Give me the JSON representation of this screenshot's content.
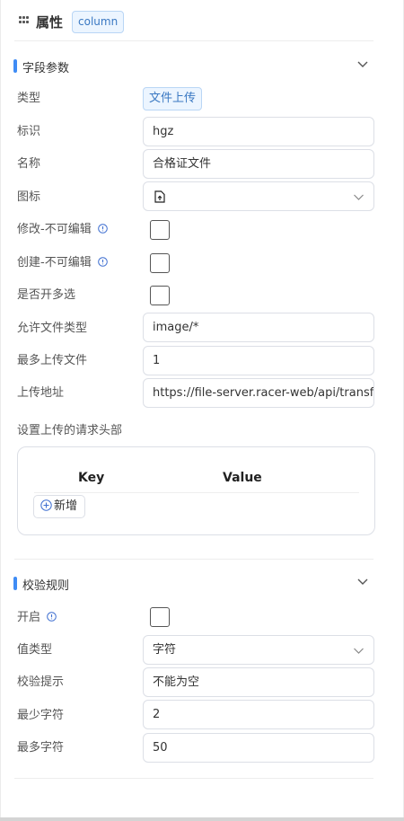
{
  "header": {
    "title": "属性",
    "tag": "column"
  },
  "field_params": {
    "section_title": "字段参数",
    "rows": {
      "type": {
        "label": "类型",
        "value": "文件上传"
      },
      "id": {
        "label": "标识",
        "value": "hgz"
      },
      "name": {
        "label": "名称",
        "value": "合格证文件"
      },
      "icon": {
        "label": "图标",
        "icon_name": "file-upload-icon"
      },
      "edit_readonly": {
        "label": "修改-不可编辑",
        "checked": false
      },
      "create_readonly": {
        "label": "创建-不可编辑",
        "checked": false
      },
      "multiple": {
        "label": "是否开多选",
        "checked": false
      },
      "file_types": {
        "label": "允许文件类型",
        "value": "image/*"
      },
      "max_files": {
        "label": "最多上传文件",
        "value": "1"
      },
      "upload_url": {
        "label": "上传地址",
        "value": "https://file-server.racer-web/api/transfer"
      }
    },
    "request_headers": {
      "label": "设置上传的请求头部",
      "col_key": "Key",
      "col_value": "Value",
      "add_label": "新增"
    }
  },
  "validation": {
    "section_title": "校验规则",
    "rows": {
      "enable": {
        "label": "开启",
        "checked": false
      },
      "value_type": {
        "label": "值类型",
        "value": "字符"
      },
      "hint": {
        "label": "校验提示",
        "value": "不能为空"
      },
      "min_chars": {
        "label": "最少字符",
        "value": "2"
      },
      "max_chars": {
        "label": "最多字符",
        "value": "50"
      }
    }
  },
  "colors": {
    "accent": "#3f8cf5",
    "tag_bg": "#ecf5ff",
    "tag_text": "#3a78c2",
    "border": "#dcdfe6"
  }
}
